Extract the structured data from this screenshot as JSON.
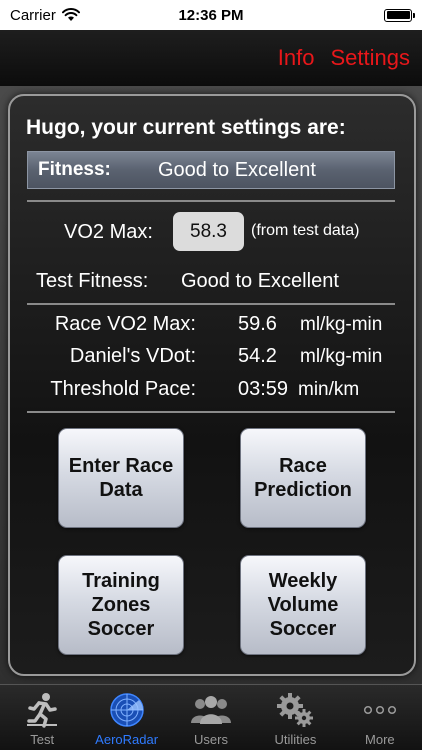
{
  "status": {
    "carrier": "Carrier",
    "time": "12:36 PM"
  },
  "nav": {
    "info": "Info",
    "settings": "Settings",
    "accent": "#e8171a"
  },
  "panel": {
    "title": "Hugo, your current settings are:",
    "fitness_label": "Fitness:",
    "fitness_value": "Good to Excellent",
    "vo2_label": "VO2 Max:",
    "vo2_value": "58.3",
    "vo2_note": "(from test data)",
    "test_fitness_label": "Test Fitness:",
    "test_fitness_value": "Good to Excellent",
    "rows": [
      {
        "label": "Race VO2 Max:",
        "value": "59.6",
        "unit": "ml/kg-min"
      },
      {
        "label": "Daniel's VDot:",
        "value": "54.2",
        "unit": "ml/kg-min"
      },
      {
        "label": "Threshold Pace:",
        "value": "03:59",
        "unit": "min/km"
      }
    ]
  },
  "buttons": {
    "enter_race": [
      "Enter Race",
      "Data"
    ],
    "race_prediction": [
      "Race",
      "Prediction"
    ],
    "training_zones": [
      "Training",
      "Zones",
      "Soccer"
    ],
    "weekly_volume": [
      "Weekly",
      "Volume",
      "Soccer"
    ]
  },
  "tabs": [
    {
      "label": "Test",
      "icon": "runner-icon"
    },
    {
      "label": "AeroRadar",
      "icon": "radar-icon",
      "active": true
    },
    {
      "label": "Users",
      "icon": "users-icon"
    },
    {
      "label": "Utilities",
      "icon": "gears-icon"
    },
    {
      "label": "More",
      "icon": "more-dots-icon"
    }
  ]
}
